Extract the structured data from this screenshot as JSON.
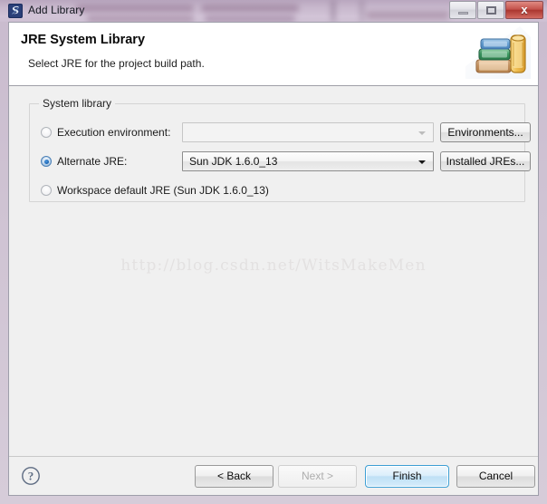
{
  "window": {
    "title": "Add Library",
    "icon": "eclipse-app-icon",
    "controls": {
      "minimize": "minimize-button",
      "maximize": "maximize-button",
      "close_label": "x"
    }
  },
  "header": {
    "title": "JRE System Library",
    "description": "Select JRE for the project build path.",
    "icon": "books-icon"
  },
  "group": {
    "legend": "System library",
    "rows": [
      {
        "radio_label": "Execution environment:",
        "selected": false,
        "combo_value": "",
        "combo_enabled": false,
        "button_label": "Environments..."
      },
      {
        "radio_label": "Alternate JRE:",
        "selected": true,
        "combo_value": "Sun JDK 1.6.0_13",
        "combo_enabled": true,
        "button_label": "Installed JREs..."
      },
      {
        "radio_label": "Workspace default JRE (Sun JDK 1.6.0_13)",
        "selected": false
      }
    ]
  },
  "watermark": "http://blog.csdn.net/WitsMakeMen",
  "buttonbar": {
    "help_icon": "help-question-icon",
    "back_label": "< Back",
    "next_label": "Next >",
    "finish_label": "Finish",
    "cancel_label": "Cancel"
  },
  "colors": {
    "accent": "#3d9fd4",
    "titlebar": "#c6b6cb",
    "body": "#f0f0f0",
    "header": "#ffffff",
    "close_button": "#c5534d",
    "watermark": "#e3e1e1"
  }
}
